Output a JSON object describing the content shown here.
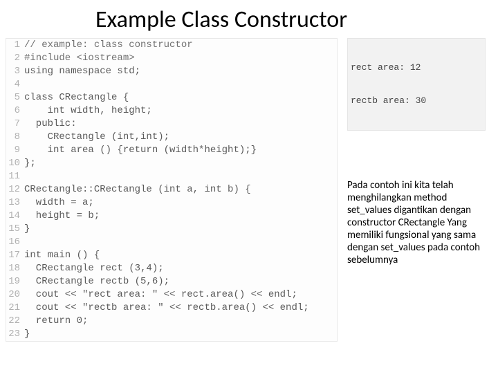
{
  "title": "Example Class Constructor",
  "code": {
    "lines": [
      {
        "n": 1,
        "txt": "// example: class constructor",
        "cls": "tok-comment"
      },
      {
        "n": 2,
        "txt": "#include <iostream>",
        "cls": "tok-keyword"
      },
      {
        "n": 3,
        "txt": "using namespace std;",
        "cls": "tok-plain"
      },
      {
        "n": 4,
        "txt": "",
        "cls": "tok-plain"
      },
      {
        "n": 5,
        "txt": "class CRectangle {",
        "cls": "tok-plain"
      },
      {
        "n": 6,
        "txt": "    int width, height;",
        "cls": "tok-plain"
      },
      {
        "n": 7,
        "txt": "  public:",
        "cls": "tok-plain"
      },
      {
        "n": 8,
        "txt": "    CRectangle (int,int);",
        "cls": "tok-plain"
      },
      {
        "n": 9,
        "txt": "    int area () {return (width*height);}",
        "cls": "tok-plain"
      },
      {
        "n": 10,
        "txt": "};",
        "cls": "tok-plain"
      },
      {
        "n": 11,
        "txt": "",
        "cls": "tok-plain"
      },
      {
        "n": 12,
        "txt": "CRectangle::CRectangle (int a, int b) {",
        "cls": "tok-plain"
      },
      {
        "n": 13,
        "txt": "  width = a;",
        "cls": "tok-plain"
      },
      {
        "n": 14,
        "txt": "  height = b;",
        "cls": "tok-plain"
      },
      {
        "n": 15,
        "txt": "}",
        "cls": "tok-plain"
      },
      {
        "n": 16,
        "txt": "",
        "cls": "tok-plain"
      },
      {
        "n": 17,
        "txt": "int main () {",
        "cls": "tok-plain"
      },
      {
        "n": 18,
        "txt": "  CRectangle rect (3,4);",
        "cls": "tok-plain"
      },
      {
        "n": 19,
        "txt": "  CRectangle rectb (5,6);",
        "cls": "tok-plain"
      },
      {
        "n": 20,
        "txt": "  cout << \"rect area: \" << rect.area() << endl;",
        "cls": "tok-plain"
      },
      {
        "n": 21,
        "txt": "  cout << \"rectb area: \" << rectb.area() << endl;",
        "cls": "tok-plain"
      },
      {
        "n": 22,
        "txt": "  return 0;",
        "cls": "tok-plain"
      },
      {
        "n": 23,
        "txt": "}",
        "cls": "tok-plain"
      }
    ]
  },
  "output": {
    "line1": "rect area: 12",
    "line2": "rectb area: 30"
  },
  "explanation": "Pada contoh ini kita telah menghilangkan method set_values digantikan dengan constructor CRectangle Yang memiliki fungsional yang sama dengan set_values pada contoh sebelumnya"
}
